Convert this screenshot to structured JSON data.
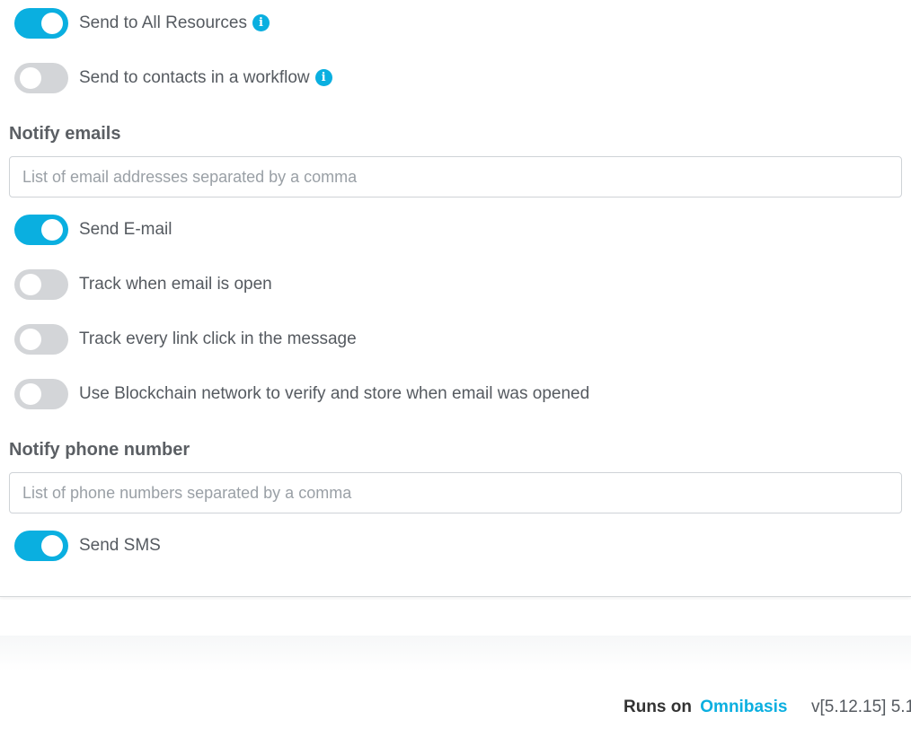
{
  "colors": {
    "accent": "#0aafe0",
    "toggle_off": "#d3d5d8",
    "text": "#555a60"
  },
  "resources": {
    "send_all": {
      "label": "Send to All Resources",
      "on": true,
      "icon": "info-icon"
    },
    "send_workflow": {
      "label": "Send to contacts in a workflow",
      "on": false,
      "icon": "info-icon"
    }
  },
  "emails": {
    "title": "Notify emails",
    "placeholder": "List of email addresses separated by a comma",
    "value": "",
    "toggles": [
      {
        "label": "Send E-mail",
        "on": true
      },
      {
        "label": "Track when email is open",
        "on": false
      },
      {
        "label": "Track every link click in the message",
        "on": false
      },
      {
        "label": "Use Blockchain network to verify and store when email was opened",
        "on": false
      }
    ]
  },
  "phone": {
    "title": "Notify phone number",
    "placeholder": "List of phone numbers separated by a comma",
    "value": "",
    "toggles": [
      {
        "label": "Send SMS",
        "on": true
      }
    ]
  },
  "footer": {
    "runs_on": "Runs on",
    "brand": "Omnibasis",
    "version": "v[5.12.15] 5.1"
  }
}
